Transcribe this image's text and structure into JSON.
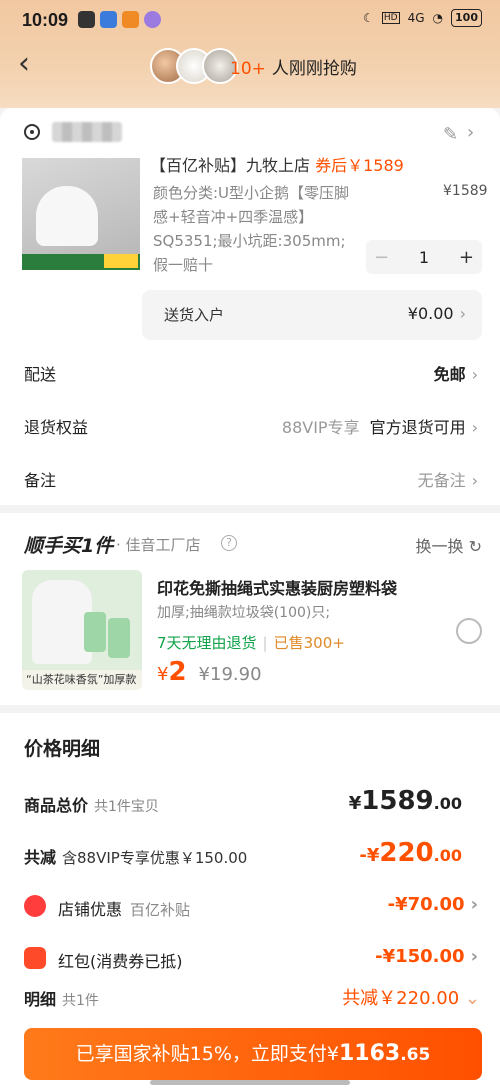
{
  "status_bar": {
    "time": "10:09",
    "network": "4G",
    "battery": "100"
  },
  "nav": {
    "buying_count": "10+",
    "buying_text": "人刚刚抢购"
  },
  "product": {
    "title_partial": "【百亿补贴】九牧上店",
    "title_price_partial": "券后￥1589",
    "sku": "颜色分类:U型小企鹅【零压脚感+轻音冲+四季温感】SQ5351;最小坑距:305mm;",
    "price": "¥1589",
    "quantity": "1",
    "guarantee": "假一赔十"
  },
  "delivery": {
    "label": "送货入户",
    "value": "¥0.00"
  },
  "shipping": {
    "label": "配送",
    "value": "免邮"
  },
  "returns": {
    "label": "退货权益",
    "badge": "88VIP专享",
    "value": "官方退货可用"
  },
  "note": {
    "label": "备注",
    "value": "无备注"
  },
  "addon": {
    "title": "顺手买1件",
    "shop": "· 佳音工厂店",
    "swap": "换一换",
    "item_title": "印花免撕抽绳式实惠装厨房塑料袋",
    "item_sku": "加厚;抽绳款垃圾袋(100)只;",
    "tag_return": "7天无理由退货",
    "tag_sold": "已售300+",
    "price_symbol": "¥",
    "price": "2",
    "original_price": "¥19.90",
    "image_label": "“山茶花味香氛”加厚款"
  },
  "price_detail": {
    "title": "价格明细",
    "total_label": "商品总价",
    "total_sub": "共1件宝贝",
    "total_symbol": "¥",
    "total_int": "1589",
    "total_dec": ".00",
    "discount_label": "共减",
    "discount_sub": "含88VIP专享优惠￥150.00",
    "discount_symbol": "-¥",
    "discount_int": "220",
    "discount_dec": ".00",
    "shop_coupon_label": "店铺优惠",
    "shop_coupon_sub": "百亿补贴",
    "shop_coupon_value": "-¥70.00",
    "redpack_label": "红包(消费券已抵)",
    "redpack_value": "-¥150.00",
    "detail_label": "明细",
    "detail_sub": "共1件",
    "detail_value": "共减￥220.00"
  },
  "pay_button": {
    "text": "已享国家补贴15%，立即支付",
    "symbol": "¥",
    "amount": "1163",
    "decimal": ".65"
  },
  "colors": {
    "accent": "#ff5000",
    "green": "#12a34a",
    "header": "#f3d1ae"
  }
}
